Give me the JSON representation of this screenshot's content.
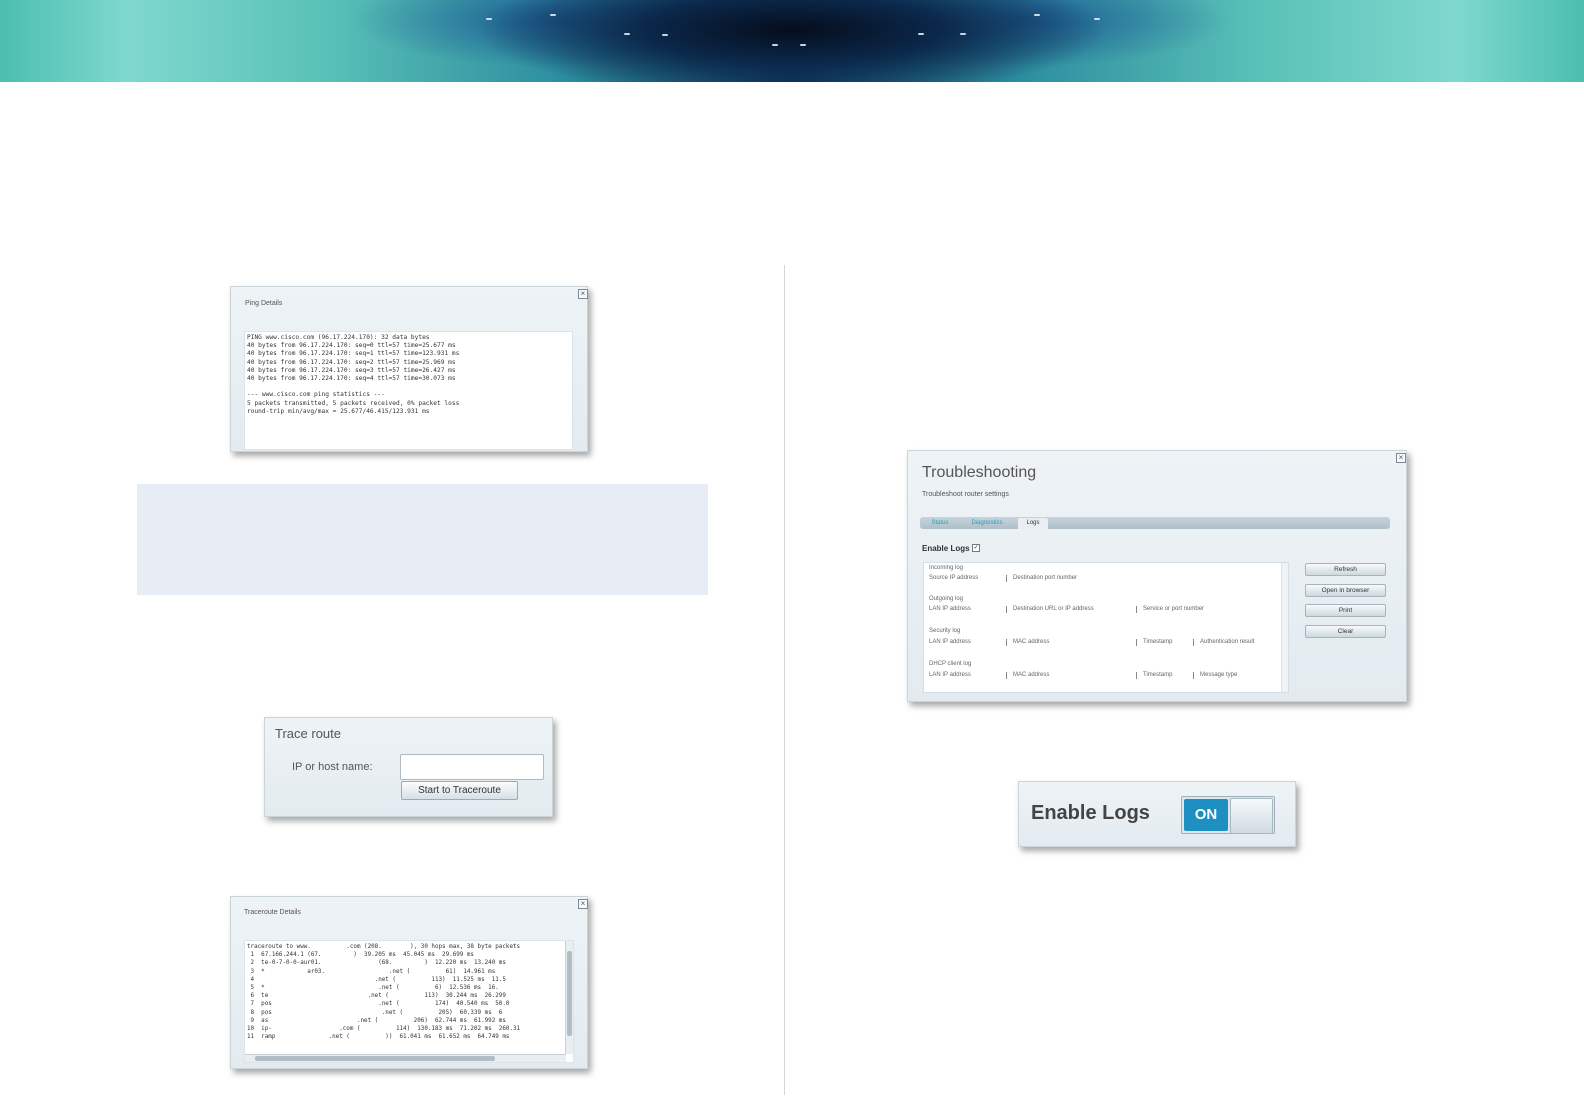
{
  "ping_dialog": {
    "title": "Ping Details",
    "output": "PING www.cisco.com (96.17.224.170): 32 data bytes\n40 bytes from 96.17.224.170: seq=0 ttl=57 time=25.677 ms\n40 bytes from 96.17.224.170: seq=1 ttl=57 time=123.931 ms\n40 bytes from 96.17.224.170: seq=2 ttl=57 time=25.969 ms\n40 bytes from 96.17.224.170: seq=3 ttl=57 time=26.427 ms\n40 bytes from 96.17.224.170: seq=4 ttl=57 time=30.073 ms\n\n--- www.cisco.com ping statistics ---\n5 packets transmitted, 5 packets received, 0% packet loss\nround-trip min/avg/max = 25.677/46.415/123.931 ms"
  },
  "traceroute_form": {
    "heading": "Trace route",
    "field_label": "IP or host name:",
    "field_value": "",
    "button_label": "Start to Traceroute"
  },
  "traceroute_dialog": {
    "title": "Traceroute Details",
    "output": "traceroute to www.          .com (208.        ), 30 hops max, 38 byte packets\n 1  67.166.244.1 (67.         )  39.205 ms  45.045 ms  29.699 ms\n 2  te-0-7-0-0-aur01.                (68.         )  12.220 ms  13.240 ms\n 3  *            ar03.                  .net (          61)  14.961 ms\n 4                                  .net (          113)  11.525 ms  11.5\n 5  *                                .net (          6)  12.536 ms  16.\n 6  te                            .net (          113)  30.244 ms  26.299\n 7  pos                              .net (          174)  40.540 ms  50.0\n 8  pos                               .net (          205)  60.339 ms  6\n 9  as                         .net (          206)  62.744 ms  61.992 ms\n10  ip-                   .com (          114)  130.183 ms  71.202 ms  260.31\n11  ramp               .net (          ))  61.041 ms  61.652 ms  64.749 ms"
  },
  "troubleshooting": {
    "title": "Troubleshooting",
    "subtitle": "Troubleshoot router settings",
    "tabs": [
      "Status",
      "Diagnostics",
      "Logs"
    ],
    "enable_logs_label": "Enable Logs",
    "logs": {
      "incoming": {
        "title": "Incoming log",
        "cols": [
          "Source IP address",
          "Destination port number"
        ]
      },
      "outgoing": {
        "title": "Outgoing log",
        "cols": [
          "LAN IP address",
          "Destination URL or IP address",
          "Service or port number"
        ]
      },
      "security": {
        "title": "Security log",
        "cols": [
          "LAN IP address",
          "MAC address",
          "Timestamp",
          "Authentication result"
        ]
      },
      "dhcp": {
        "title": "DHCP client log",
        "cols": [
          "LAN IP address",
          "MAC address",
          "Timestamp",
          "Message type"
        ]
      }
    },
    "buttons": [
      "Refresh",
      "Open in browser",
      "Print",
      "Clear"
    ]
  },
  "enable_logs_toggle": {
    "label": "Enable Logs",
    "state": "ON"
  }
}
